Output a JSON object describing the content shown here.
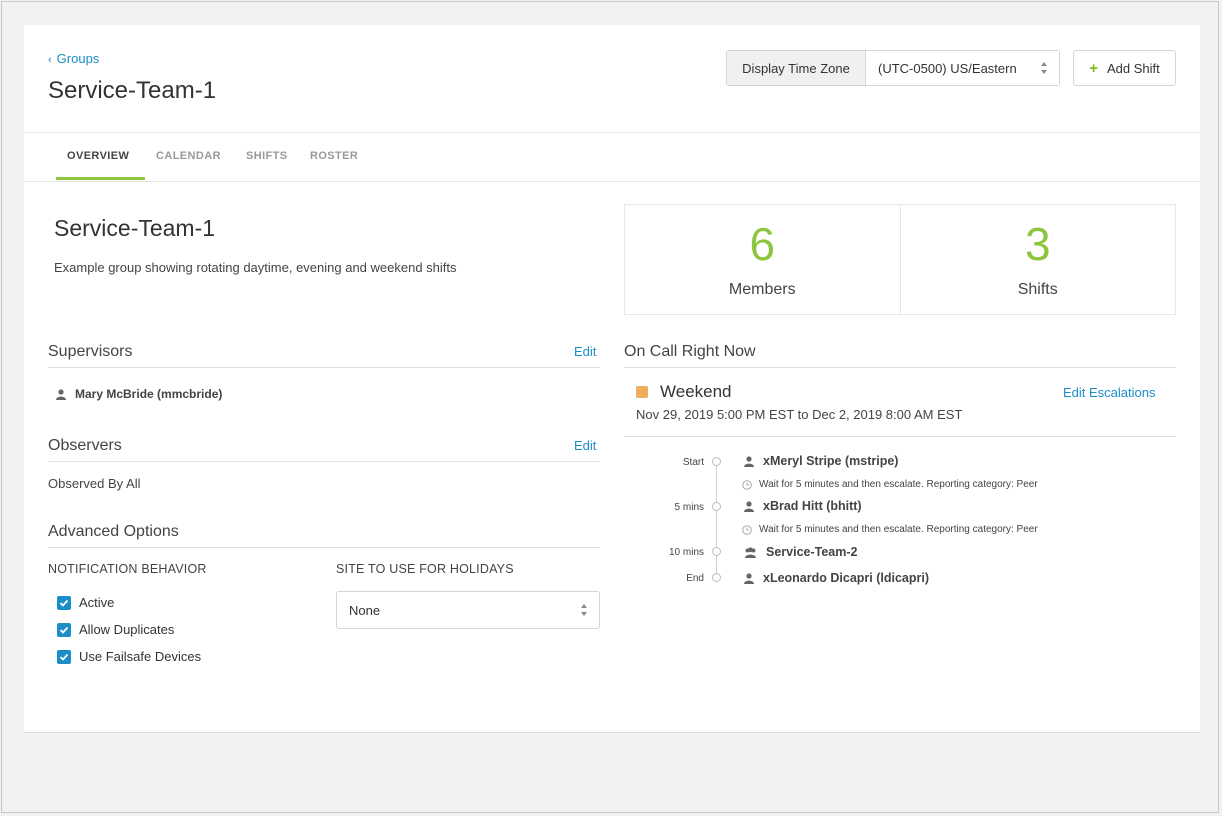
{
  "header": {
    "back_label": "Groups",
    "title": "Service-Team-1",
    "timezone_label": "Display Time Zone",
    "timezone_value": "(UTC-0500) US/Eastern",
    "add_shift_label": "Add Shift"
  },
  "tabs": [
    {
      "label": "OVERVIEW",
      "active": true
    },
    {
      "label": "CALENDAR",
      "active": false
    },
    {
      "label": "SHIFTS",
      "active": false
    },
    {
      "label": "ROSTER",
      "active": false
    }
  ],
  "overview": {
    "name": "Service-Team-1",
    "description": "Example group showing rotating daytime, evening and weekend shifts",
    "members_count": "6",
    "members_label": "Members",
    "shifts_count": "3",
    "shifts_label": "Shifts"
  },
  "supervisors": {
    "title": "Supervisors",
    "edit_label": "Edit",
    "people": [
      "Mary McBride (mmcbride)"
    ]
  },
  "observers": {
    "title": "Observers",
    "edit_label": "Edit",
    "value": "Observed By All"
  },
  "advanced": {
    "title": "Advanced Options",
    "notification_label": "NOTIFICATION BEHAVIOR",
    "holidays_label": "SITE TO USE FOR HOLIDAYS",
    "options": [
      {
        "label": "Active",
        "checked": true
      },
      {
        "label": "Allow Duplicates",
        "checked": true
      },
      {
        "label": "Use Failsafe Devices",
        "checked": true
      }
    ],
    "holiday_site": "None"
  },
  "on_call": {
    "title": "On Call Right Now",
    "shift_name": "Weekend",
    "shift_color": "#f0ad5b",
    "shift_range": "Nov 29, 2019 5:00 PM EST to Dec 2, 2019 8:00 AM EST",
    "edit_escalations_label": "Edit Escalations",
    "steps": [
      {
        "time": "Start",
        "who": "xMeryl Stripe (mstripe)",
        "icon": "user-icon",
        "note": "Wait for 5 minutes and then escalate. Reporting category: Peer"
      },
      {
        "time": "5 mins",
        "who": "xBrad Hitt (bhitt)",
        "icon": "user-icon",
        "note": "Wait for 5 minutes and then escalate. Reporting category: Peer"
      },
      {
        "time": "10 mins",
        "who": "Service-Team-2",
        "icon": "group-icon",
        "note": ""
      },
      {
        "time": "End",
        "who": "xLeonardo Dicapri (ldicapri)",
        "icon": "user-icon",
        "note": ""
      }
    ]
  },
  "colors": {
    "accent_green": "#8cc63f",
    "link_blue": "#1b8ec9"
  }
}
